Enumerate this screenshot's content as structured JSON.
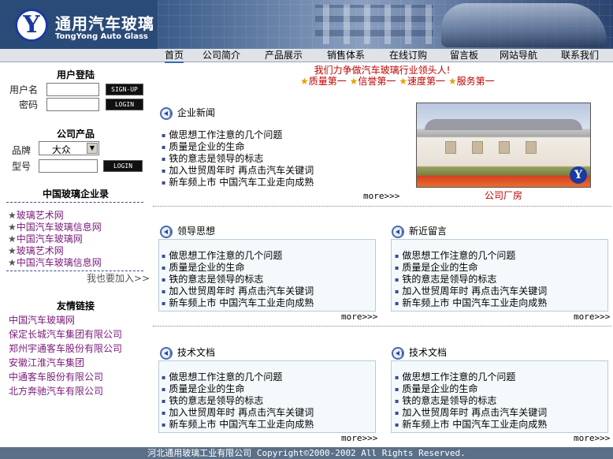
{
  "brand": {
    "logo_glyph": "Y",
    "name_cn": "通用汽车玻璃",
    "name_en": "TongYong Auto Glass",
    "primary_color": "#1a3aa0"
  },
  "nav": {
    "items": [
      "首页",
      "公司简介",
      "产品展示",
      "销售体系",
      "在线订购",
      "留言板",
      "网站导航",
      "联系我们"
    ],
    "active": "首页"
  },
  "login": {
    "title": "用户登陆",
    "username_label": "用户名",
    "password_label": "密码",
    "username_value": "",
    "password_value": "",
    "signup_label": "SIGN-UP",
    "login_label": "LOGIN"
  },
  "product": {
    "title": "公司产品",
    "brand_label": "品牌",
    "brand_value": "大众",
    "model_label": "型号",
    "model_value": "",
    "login_label": "LOGIN"
  },
  "enterprises": {
    "title": "中国玻璃企业录",
    "items": [
      "玻璃艺术网",
      "中国汽车玻璃信息网",
      "中国汽车玻璃网",
      "玻璃艺术网",
      "中国汽车玻璃信息网"
    ],
    "join_link": "我也要加入>>"
  },
  "friends": {
    "title": "友情链接",
    "items": [
      "中国汽车玻璃网",
      "保定长城汽车集团有限公司",
      "郑州宇通客车股份有限公司",
      "安徽江淮汽车集团",
      "中通客车股份有限公司",
      "北方奔驰汽车有限公司"
    ]
  },
  "slogan": "我们力争做汽车玻璃行业领头人!",
  "pillars": [
    "质量第一",
    "信誉第一",
    "速度第一",
    "服务第一"
  ],
  "sections": {
    "company_news": {
      "title": "企业新闻",
      "items": [
        "做思想工作注意的几个问题",
        "质量是企业的生命",
        "铁的意志是领导的标志",
        "加入世贸周年时  再点击汽车关键词",
        "新车频上市  中国汽车工业走向成熟"
      ],
      "more": "more>>>"
    },
    "leader_thoughts": {
      "title": "领导思想",
      "items": [
        "做思想工作注意的几个问题",
        "质量是企业的生命",
        "铁的意志是领导的标志",
        "加入世贸周年时  再点击汽车关键词",
        "新车频上市  中国汽车工业走向成熟"
      ],
      "more": "more>>>"
    },
    "recent_messages": {
      "title": "新近留言",
      "items": [
        "做思想工作注意的几个问题",
        "质量是企业的生命",
        "铁的意志是领导的标志",
        "加入世贸周年时  再点击汽车关键词",
        "新车频上市  中国汽车工业走向成熟"
      ],
      "more": "more>>>"
    },
    "tech_docs_1": {
      "title": "技术文档",
      "items": [
        "做思想工作注意的几个问题",
        "质量是企业的生命",
        "铁的意志是领导的标志",
        "加入世贸周年时  再点击汽车关键词",
        "新车频上市  中国汽车工业走向成熟"
      ],
      "more": "more>>>"
    },
    "tech_docs_2": {
      "title": "技术文档",
      "items": [
        "做思想工作注意的几个问题",
        "质量是企业的生命",
        "铁的意志是领导的标志",
        "加入世贸周年时  再点击汽车关键词",
        "新车频上市  中国汽车工业走向成熟"
      ],
      "more": "more>>>"
    }
  },
  "factory_caption": "公司厂房",
  "footer": "河北通用玻璃工业有限公司 Copyright©2000-2002 All Rights Reserved."
}
